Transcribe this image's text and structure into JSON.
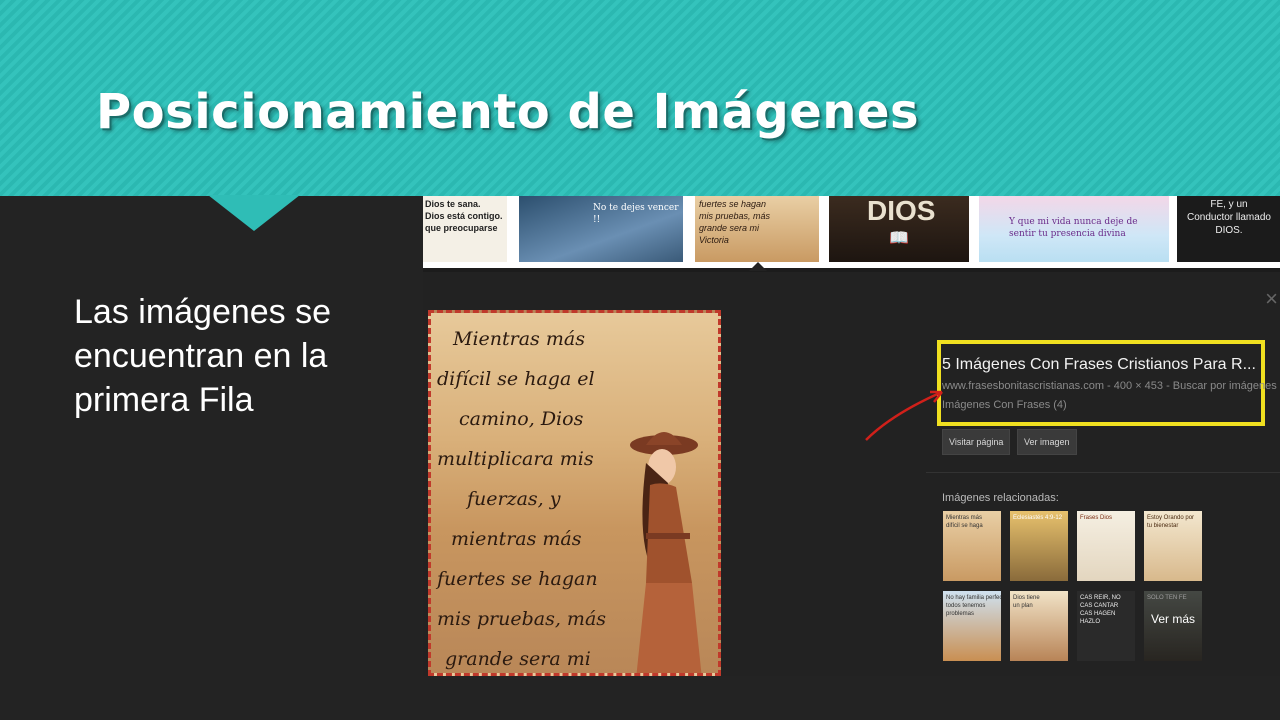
{
  "slide": {
    "title": "Posicionamiento de Imágenes",
    "body": "Las imágenes se encuentran en la primera Fila"
  },
  "strip": {
    "thumbs": [
      {
        "text": "Dios te sana.\nDios está contigo.\nque preocuparse"
      },
      {
        "text": "No te dejes vencer !!"
      },
      {
        "text": "fuertes se hagan\nmis pruebas, más\ngrande sera mi\nVictoria"
      },
      {
        "text": "DIOS"
      },
      {
        "text": "Y que mi vida nunca deje de\nsentir tu presencia divina"
      },
      {
        "text": "FE, y un\nConductor llamado\nDIOS."
      }
    ]
  },
  "main_image": {
    "quote": [
      "Mientras más",
      "difícil se haga el",
      "camino, Dios",
      "multiplicara mis",
      "fuerzas, y",
      "mientras más",
      "fuertes se hagan",
      "mis pruebas, más",
      "grande sera mi"
    ]
  },
  "info": {
    "title": "5 Imágenes Con Frases Cristianos Para R...",
    "source": "www.frasesbonitascristianas.com - 400 × 453 - Buscar por imágenes",
    "album": "Imágenes Con Frases (4)",
    "visit_button": "Visitar página",
    "view_button": "Ver imagen",
    "related_label": "Imágenes relacionadas:",
    "more_label": "Ver más",
    "close": "×"
  },
  "related": [
    {
      "text": "Mientras más\ndifícil se haga"
    },
    {
      "text": "Eclesiastés 4:9-12"
    },
    {
      "text": "Frases Dios"
    },
    {
      "text": "Estoy Orando por\ntu bienestar"
    },
    {
      "text": "No hay familia perfecta\ntodos tenemos\nproblemas"
    },
    {
      "text": "Dios tiene\nun plan"
    },
    {
      "text": "CAS REIR, NO\nCAS CANTAR\nCAS HAGEN\nHAZLO"
    },
    {
      "text": "SOLO TEN FE"
    }
  ],
  "colors": {
    "banner": "#2bb8b1",
    "background": "#232323",
    "highlight": "#f0e020",
    "arrow": "#d0201a"
  }
}
